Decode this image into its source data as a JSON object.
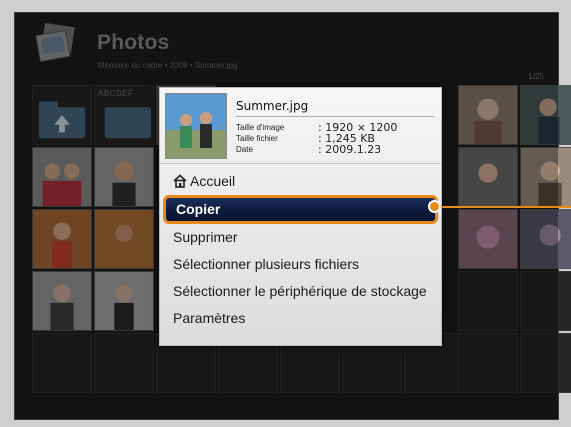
{
  "header": {
    "title": "Photos",
    "breadcrumb": "Mémoire du cadre • 2009 • Summer.jpg",
    "page_counter": "1/25"
  },
  "grid": {
    "folder_label": "ABCDEF"
  },
  "popup": {
    "file_name": "Summer.jpg",
    "meta": [
      {
        "label": "Taille d'image",
        "value": ": 1920 × 1200"
      },
      {
        "label": "Taille fichier",
        "value": ": 1,245 KB"
      },
      {
        "label": "Date",
        "value": ": 2009.1.23"
      }
    ],
    "menu": [
      {
        "label": "Accueil",
        "icon": "home-icon"
      },
      {
        "label": "Copier",
        "selected": true
      },
      {
        "label": "Supprimer"
      },
      {
        "label": "Sélectionner plusieurs fichiers"
      },
      {
        "label": "Sélectionner le périphérique de stockage"
      },
      {
        "label": "Paramètres"
      }
    ]
  },
  "colors": {
    "highlight_border": "#e88a1a",
    "selected_bg": "#0d1a3a"
  }
}
